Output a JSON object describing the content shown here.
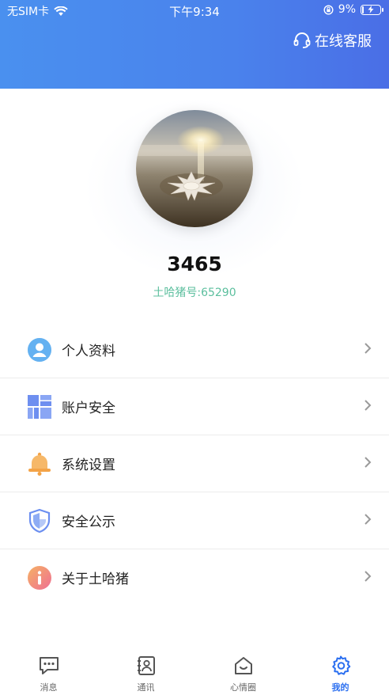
{
  "status_bar": {
    "carrier": "无SIM卡",
    "time": "下午9:34",
    "battery_percent": "9%",
    "battery_level": 0.09
  },
  "header": {
    "support_label": "在线客服",
    "support_icon": "headset-icon"
  },
  "profile": {
    "username": "3465",
    "user_id": "土哈猪号:65290"
  },
  "menu": [
    {
      "label": "个人资料",
      "icon": "user-icon",
      "color": "#4aa3ef"
    },
    {
      "label": "账户安全",
      "icon": "grid-icon",
      "color": "#6e8ff0"
    },
    {
      "label": "系统设置",
      "icon": "bell-icon",
      "color": "#f3a347"
    },
    {
      "label": "安全公示",
      "icon": "shield-icon",
      "color": "#6c8ff0"
    },
    {
      "label": "关于土哈猪",
      "icon": "info-icon",
      "color": "#f0768f"
    }
  ],
  "tabs": [
    {
      "label": "消息",
      "icon": "message-icon"
    },
    {
      "label": "通讯",
      "icon": "contacts-icon"
    },
    {
      "label": "心情圈",
      "icon": "house-icon"
    },
    {
      "label": "我的",
      "icon": "settings-icon",
      "active": true
    }
  ],
  "colors": {
    "accent": "#2b6ff0",
    "header_start": "#4a90ef",
    "header_end": "#4a6ee6",
    "user_id_color": "#5cbf9e"
  }
}
